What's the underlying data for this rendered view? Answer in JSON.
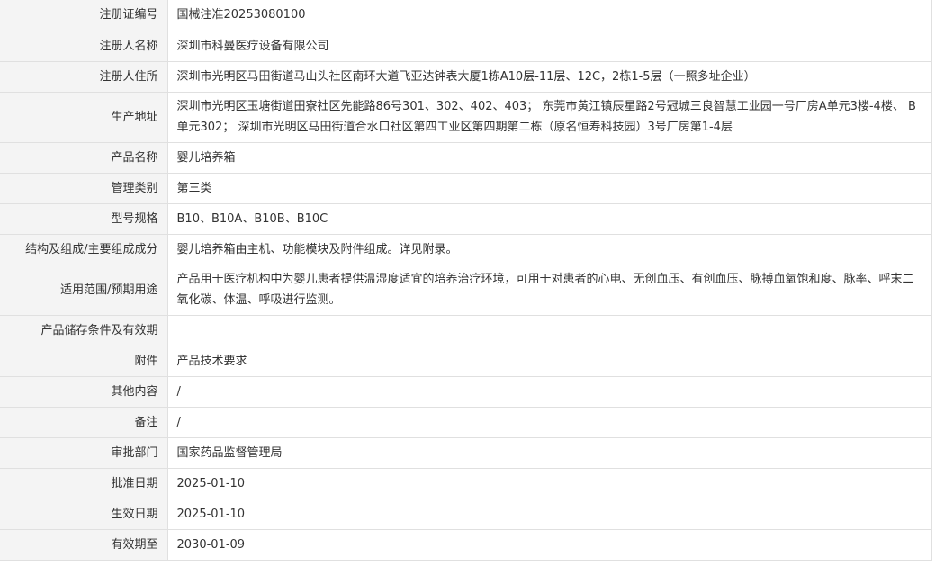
{
  "rows": [
    {
      "label": "注册证编号",
      "value": "国械注准20253080100"
    },
    {
      "label": "注册人名称",
      "value": "深圳市科曼医疗设备有限公司"
    },
    {
      "label": "注册人住所",
      "value": "深圳市光明区马田街道马山头社区南环大道飞亚达钟表大厦1栋A10层-11层、12C，2栋1-5层（一照多址企业）"
    },
    {
      "label": "生产地址",
      "value": "深圳市光明区玉塘街道田寮社区先能路86号301、302、402、403； 东莞市黄江镇辰星路2号冠城三良智慧工业园一号厂房A单元3楼-4楼、 B单元302； 深圳市光明区马田街道合水口社区第四工业区第四期第二栋（原名恒寿科技园）3号厂房第1-4层"
    },
    {
      "label": "产品名称",
      "value": "婴儿培养箱"
    },
    {
      "label": "管理类别",
      "value": "第三类"
    },
    {
      "label": "型号规格",
      "value": "B10、B10A、B10B、B10C"
    },
    {
      "label": "结构及组成/主要组成成分",
      "value": "婴儿培养箱由主机、功能模块及附件组成。详见附录。"
    },
    {
      "label": "适用范围/预期用途",
      "value": "产品用于医疗机构中为婴儿患者提供温湿度适宜的培养治疗环境，可用于对患者的心电、无创血压、有创血压、脉搏血氧饱和度、脉率、呼末二氧化碳、体温、呼吸进行监测。"
    },
    {
      "label": "产品储存条件及有效期",
      "value": ""
    },
    {
      "label": "附件",
      "value": "产品技术要求"
    },
    {
      "label": "其他内容",
      "value": "/"
    },
    {
      "label": "备注",
      "value": "/"
    },
    {
      "label": "审批部门",
      "value": "国家药品监督管理局"
    },
    {
      "label": "批准日期",
      "value": "2025-01-10"
    },
    {
      "label": "生效日期",
      "value": "2025-01-10"
    },
    {
      "label": "有效期至",
      "value": "2030-01-09"
    }
  ]
}
